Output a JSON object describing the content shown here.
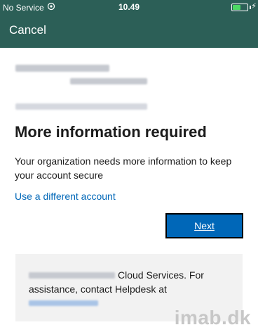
{
  "status_bar": {
    "carrier": "No Service",
    "time": "10.49",
    "battery_level": 0.55,
    "battery_color": "#4cd964",
    "bar_color": "#2c5f57",
    "wifi_icon": "wifi-icon",
    "bolt_icon": "charging-bolt-icon"
  },
  "nav": {
    "cancel_label": "Cancel"
  },
  "content": {
    "heading": "More information required",
    "body": "Your organization needs more information to keep your account secure",
    "link": "Use a different account",
    "next_label": "Next"
  },
  "footer": {
    "line1_suffix": "Cloud Services. For",
    "line2": "assistance, contact Helpdesk at"
  },
  "watermark": "imab.dk",
  "colors": {
    "accent": "#0067b8",
    "footer_bg": "#f2f2f2"
  }
}
